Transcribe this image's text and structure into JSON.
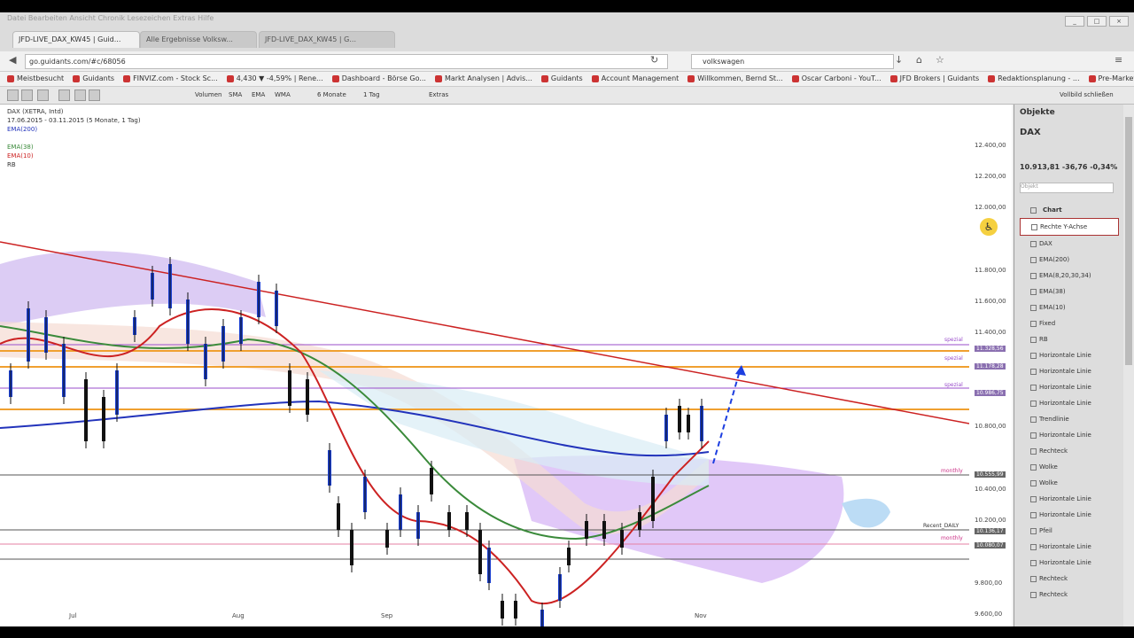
{
  "window": {
    "title": "Datei  Bearbeiten  Ansicht  Chronik  Lesezeichen  Extras  Hilfe"
  },
  "tabs": [
    {
      "label": "JFD-LIVE_DAX_KW45 | Guid...",
      "active": true
    },
    {
      "label": "Alle Ergebnisse Volksw...",
      "active": false
    },
    {
      "label": "JFD-LIVE_DAX_KW45 | G...",
      "active": false
    }
  ],
  "address": {
    "url": "go.guidants.com/#c/68056",
    "search": "volkswagen"
  },
  "bookmarks": [
    "Meistbesucht",
    "Guidants",
    "FINVIZ.com - Stock Sc...",
    "4,430 ▼ -4,59% | Rene...",
    "Dashboard - Börse Go...",
    "Markt Analysen | Advis...",
    "Guidants",
    "Account Management",
    "Willkommen, Bernd St...",
    "Oscar Carboni - YouT...",
    "JFD Brokers | Guidants",
    "Redaktionsplanung - ...",
    "Pre-Market Most Activ..."
  ],
  "chart_toolbar": {
    "indicators": [
      "Volumen",
      "SMA",
      "EMA",
      "WMA"
    ],
    "range": "6 Monate",
    "interval": "1 Tag",
    "extras": "Extras",
    "fullscreen": "Vollbild schließen"
  },
  "chart": {
    "title": "DAX (XETRA, Intd)",
    "date_range": "17.06.2015 - 03.11.2015 (5 Monate, 1 Tag)",
    "legend": [
      "EMA(200)",
      "EMA(38)",
      "EMA(10)",
      "RB"
    ],
    "y_ticks": [
      "12.400,00",
      "12.200,00",
      "12.000,00",
      "11.800,00",
      "11.600,00",
      "11.400,00",
      "10.800,00",
      "10.400,00",
      "10.200,00",
      "9.800,00",
      "9.600,00"
    ],
    "x_ticks": [
      "Jul",
      "Aug",
      "Sep",
      "Nov"
    ],
    "levels": [
      {
        "label": "spezial",
        "value": "11.328,56"
      },
      {
        "label": "spezial",
        "value": "11.178,28"
      },
      {
        "label": "spezial",
        "value": "10.986,75"
      },
      {
        "label": "monthly",
        "value": "10.555,99"
      },
      {
        "label": "Recent_DAILY",
        "value": "10.136,17"
      },
      {
        "label": "monthly",
        "value": "10.080,07"
      }
    ]
  },
  "side_panel": {
    "title": "Objekte",
    "symbol": "DAX",
    "price": "10.913,81  -36,76  -0,34%",
    "search_placeholder": "Objekt",
    "items": [
      "Chart",
      "Rechte Y-Achse",
      "DAX",
      "EMA(200)",
      "EMA(8,20,30,34)",
      "EMA(38)",
      "EMA(10)",
      "Fixed",
      "RB",
      "Horizontale Linie",
      "Horizontale Linie",
      "Horizontale Linie",
      "Horizontale Linie",
      "Trendlinie",
      "Horizontale Linie",
      "Rechteck",
      "Wolke",
      "Wolke",
      "Horizontale Linie",
      "Horizontale Linie",
      "Pfeil",
      "Horizontale Linie",
      "Horizontale Linie",
      "Rechteck",
      "Rechteck"
    ]
  }
}
